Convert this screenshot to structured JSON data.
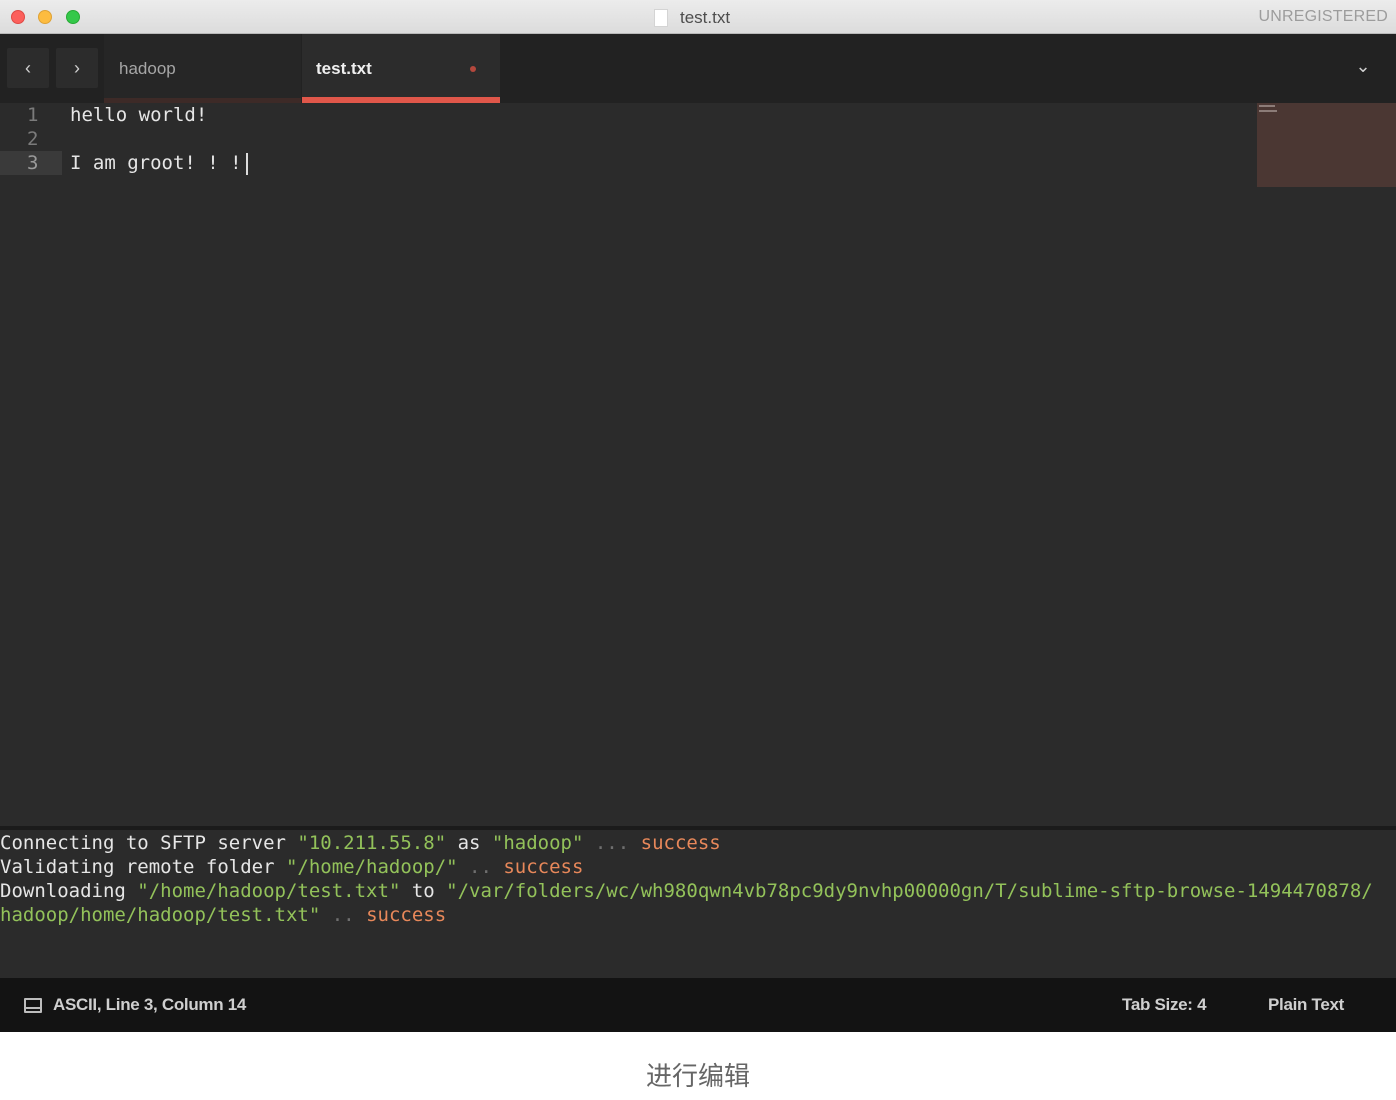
{
  "window": {
    "title": "test.txt",
    "registration": "UNREGISTERED"
  },
  "tabs": [
    {
      "label": "hadoop",
      "active": false
    },
    {
      "label": "test.txt",
      "active": true,
      "dirty": true
    }
  ],
  "nav": {
    "back_icon": "‹",
    "forward_icon": "›",
    "tab_menu_icon": "⌄"
  },
  "editor": {
    "lines": [
      {
        "number": "1",
        "text": "hello world!"
      },
      {
        "number": "2",
        "text": ""
      },
      {
        "number": "3",
        "text": "I am groot! ! !"
      }
    ],
    "current_line": 3
  },
  "output": {
    "line1": {
      "a": "Connecting to SFTP server ",
      "b": "\"10.211.55.8\"",
      "c": " as ",
      "d": "\"hadoop\"",
      "e": " ... ",
      "f": "success"
    },
    "line2": {
      "a": "Validating remote folder ",
      "b": "\"/home/hadoop/\"",
      "c": " .. ",
      "d": "success"
    },
    "line3": {
      "a": "Downloading ",
      "b": "\"/home/hadoop/test.txt\"",
      "c": " to ",
      "d": "\"/var/folders/wc/wh980qwn4vb78pc9dy9nvhp00000gn/T/sublime-sftp-browse-1494470878/"
    },
    "line4": {
      "a": "hadoop/home/hadoop/test.txt\"",
      "b": " .. ",
      "c": "success"
    }
  },
  "status": {
    "position": "ASCII, Line 3, Column 14",
    "tab_size": "Tab Size: 4",
    "syntax": "Plain Text"
  },
  "caption": "进行编辑",
  "colors": {
    "accent_tab": "#e0574a",
    "string": "#93c25a",
    "success": "#e8885a",
    "editor_bg": "#2b2b2b"
  }
}
